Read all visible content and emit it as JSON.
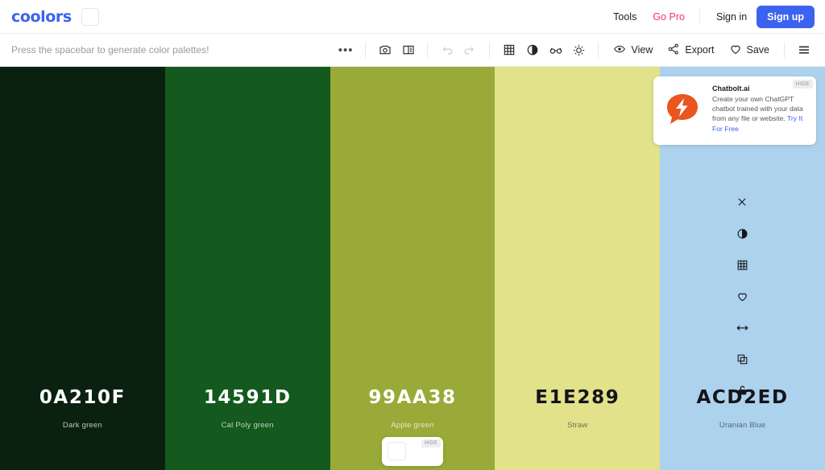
{
  "header": {
    "logo": "coolors",
    "logo_color": "#3B63F0",
    "nav": [
      {
        "label": "Tools",
        "name": "nav-tools"
      },
      {
        "label": "Go Pro",
        "name": "nav-go-pro",
        "color": "#F0356F"
      }
    ],
    "sign_in": "Sign in",
    "sign_up": "Sign up"
  },
  "toolbar": {
    "hint": "Press the spacebar to generate color palettes!",
    "more_dots": "•••",
    "icons": [
      {
        "name": "camera-icon",
        "title": "Screenshot"
      },
      {
        "name": "split-view-icon",
        "title": "View image"
      },
      {
        "name": "undo-icon",
        "title": "Undo",
        "disabled": true
      },
      {
        "name": "redo-icon",
        "title": "Redo",
        "disabled": true
      },
      {
        "name": "grid-icon",
        "title": "Grid"
      },
      {
        "name": "contrast-icon",
        "title": "Adjust"
      },
      {
        "name": "glasses-icon",
        "title": "Color blindness"
      },
      {
        "name": "brightness-icon",
        "title": "Brightness"
      }
    ],
    "buttons": [
      {
        "label": "View",
        "icon": "eye-icon",
        "name": "view-button"
      },
      {
        "label": "Export",
        "icon": "share-icon",
        "name": "export-button"
      },
      {
        "label": "Save",
        "icon": "heart-icon",
        "name": "save-button"
      }
    ],
    "menu": "hamburger-menu-icon"
  },
  "palette": {
    "swatches": [
      {
        "hex": "0A210F",
        "name": "Dark green",
        "css": "#0A210F",
        "text": "light"
      },
      {
        "hex": "14591D",
        "name": "Cal Poly green",
        "css": "#14591D",
        "text": "light"
      },
      {
        "hex": "99AA38",
        "name": "Apple green",
        "css": "#99AA38",
        "text": "light"
      },
      {
        "hex": "E1E289",
        "name": "Straw",
        "css": "#E1E289",
        "text": "dark"
      },
      {
        "hex": "ACD2ED",
        "name": "Uranian Blue",
        "css": "#ACD2ED",
        "text": "dark"
      }
    ]
  },
  "swatch_tools": [
    {
      "name": "close-icon",
      "glyph": "✕"
    },
    {
      "name": "contrast-icon",
      "glyph": "contrast"
    },
    {
      "name": "grid-icon",
      "glyph": "grid"
    },
    {
      "name": "heart-icon",
      "glyph": "heart"
    },
    {
      "name": "drag-icon",
      "glyph": "↔"
    },
    {
      "name": "copy-icon",
      "glyph": "copy"
    },
    {
      "name": "lock-icon",
      "glyph": "lock"
    }
  ],
  "ad": {
    "title": "Chatbolt.ai",
    "body": "Create your own ChatGPT chatbot trained with your data from any file or website. ",
    "cta": "Try It For Free",
    "hide": "HIDE",
    "logo_color": "#EA5520"
  },
  "mini_ad": {
    "hide": "HIDE"
  }
}
